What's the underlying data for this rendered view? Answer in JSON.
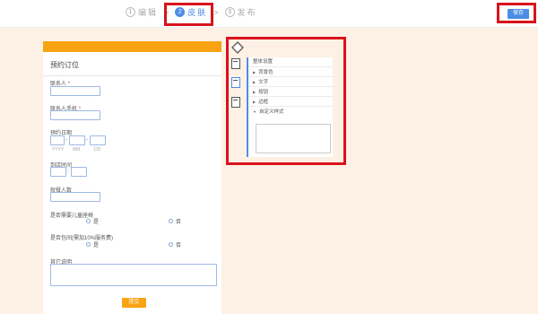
{
  "steps": [
    {
      "num": "1",
      "label": "编辑"
    },
    {
      "num": "2",
      "label": "皮肤"
    },
    {
      "num": "3",
      "label": "发布"
    }
  ],
  "sep": ">",
  "save_label": "保存",
  "form": {
    "title": "预约订位",
    "name_label": "联系人",
    "phone_label": "联系人手机",
    "req": "*",
    "date_label": "预约日期",
    "date_hints": [
      "YYYY",
      "MM",
      "DD"
    ],
    "date_sep": "-",
    "time_label": "到店时间",
    "time_sep": ":",
    "count_label": "就餐人数",
    "q1_label": "是否需要儿童座椅",
    "q2_label": "是否包间(需加10%服务费)",
    "yes": "是",
    "no": "否",
    "other_label": "其它说明",
    "submit_label": "提交"
  },
  "settings": {
    "header": "整体设置",
    "items": [
      "背景色",
      "文字",
      "按钮",
      "边框",
      "自定义样式"
    ]
  },
  "colors": {
    "accent": "#4d8de6",
    "brand": "#f8a312",
    "highlight": "#d8131b"
  }
}
